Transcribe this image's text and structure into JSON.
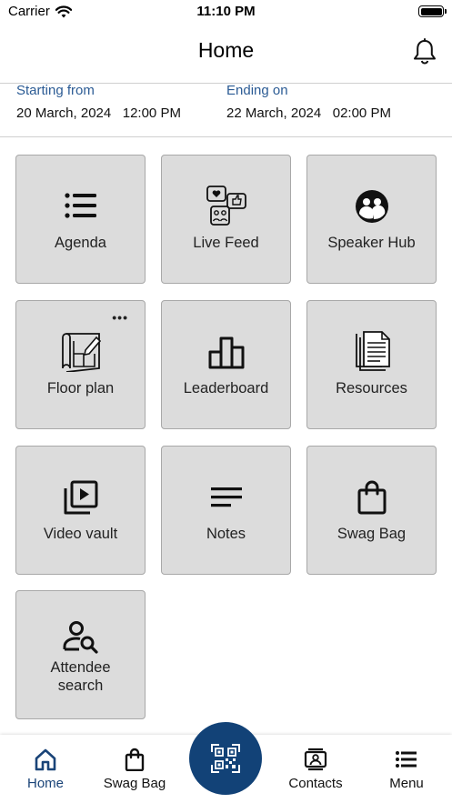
{
  "status_bar": {
    "carrier": "Carrier",
    "time": "11:10 PM"
  },
  "header": {
    "title": "Home"
  },
  "event_dates": {
    "start_label": "Starting from",
    "start_value": "20 March, 2024   12:00 PM",
    "end_label": "Ending on",
    "end_value": "22 March, 2024   02:00 PM"
  },
  "tiles": [
    {
      "label": "Agenda",
      "icon": "list-icon"
    },
    {
      "label": "Live Feed",
      "icon": "social-feed-icon"
    },
    {
      "label": "Speaker Hub",
      "icon": "people-circle-icon"
    },
    {
      "label": "Floor plan",
      "icon": "blueprint-icon"
    },
    {
      "label": "Leaderboard",
      "icon": "podium-icon"
    },
    {
      "label": "Resources",
      "icon": "documents-icon"
    },
    {
      "label": "Video vault",
      "icon": "video-library-icon"
    },
    {
      "label": "Notes",
      "icon": "notes-lines-icon"
    },
    {
      "label": "Swag Bag",
      "icon": "shopping-bag-icon"
    },
    {
      "label": "Attendee\nsearch",
      "icon": "person-search-icon"
    }
  ],
  "tabbar": {
    "items": [
      {
        "label": "Home",
        "icon": "home-icon",
        "active": true
      },
      {
        "label": "Swag Bag",
        "icon": "shopping-bag-icon"
      },
      {
        "label": "Contacts",
        "icon": "contacts-icon"
      },
      {
        "label": "Menu",
        "icon": "menu-icon"
      }
    ],
    "center_icon": "qr-code-icon"
  },
  "colors": {
    "accent": "#124277",
    "date_label": "#2b5b94",
    "tile_bg": "#dcdcdc",
    "tile_border": "#a8a8a8"
  }
}
